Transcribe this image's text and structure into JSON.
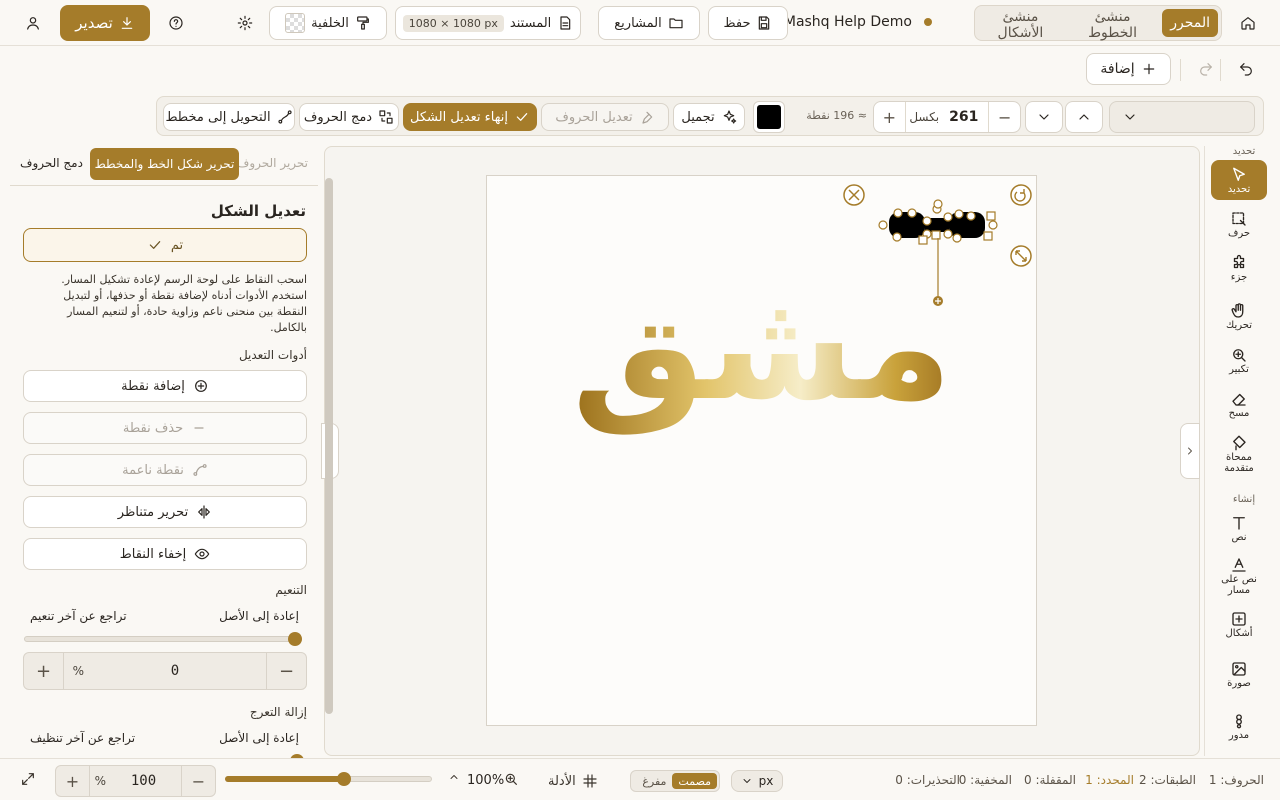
{
  "topbar": {
    "mode_tabs": [
      "المحرر",
      "منشئ الخطوط",
      "منشئ الأشكال"
    ],
    "project_name": "Mashq Help Demo",
    "save_label": "حفظ",
    "projects_label": "المشاريع",
    "document_label": "المستند",
    "document_size": "1080 × 1080 px",
    "background_label": "الخلفية",
    "export_label": "تصدير"
  },
  "row2": {
    "add_label": "إضافة"
  },
  "toolbar": {
    "size_value": "261",
    "size_unit": "بكسل",
    "pt_value": "≈ 196 نقطة",
    "color": "#000000",
    "beautify_label": "تجميل",
    "edit_letters_label": "تعديل الحروف",
    "finish_shape_label": "إنهاء تعديل الشكل",
    "merge_letters_label": "دمج الحروف",
    "convert_path_label": "التحويل إلى مخطط"
  },
  "rail": {
    "select_header": "تحديد",
    "create_header": "إنشاء",
    "items": [
      {
        "label": "تحديد",
        "icon": "cursor-icon"
      },
      {
        "label": "حرف",
        "icon": "letter-select-icon"
      },
      {
        "label": "جزء",
        "icon": "puzzle-icon"
      },
      {
        "label": "تحريك",
        "icon": "hand-icon"
      },
      {
        "label": "تكبير",
        "icon": "zoom-icon"
      },
      {
        "label": "مسح",
        "icon": "eraser-icon"
      },
      {
        "label": "ممحاة متقدمة",
        "icon": "advanced-eraser-icon"
      },
      {
        "label": "نص",
        "icon": "text-icon"
      },
      {
        "label": "نص على مسار",
        "icon": "text-path-icon"
      },
      {
        "label": "أشكال",
        "icon": "shapes-icon"
      },
      {
        "label": "صورة",
        "icon": "image-icon"
      },
      {
        "label": "مدور",
        "icon": "rotate-shape-icon"
      }
    ]
  },
  "canvas": {
    "artwork_text": "مشق",
    "gradient": [
      "#9a6f1a",
      "#e2c46a",
      "#f6edc8",
      "#c9a23b",
      "#a07422"
    ]
  },
  "panel": {
    "tabs": [
      "تحرير الحروف",
      "تحرير شكل الخط والمخطط",
      "دمج الحروف"
    ],
    "section_title": "تعديل الشكل",
    "done_label": "تم",
    "help_text": "اسحب النقاط على لوحة الرسم لإعادة تشكيل المسار. استخدم الأدوات أدناه لإضافة نقطة أو حذفها، أو لتبديل النقطة بين منحنى ناعم وزاوية حادة، أو لتنعيم المسار بالكامل.",
    "tools_title": "أدوات التعديل",
    "add_point": "إضافة نقطة",
    "delete_point": "حذف نقطة",
    "smooth_point": "نقطة ناعمة",
    "symmetric_edit": "تحرير متناظر",
    "hide_points": "إخفاء النقاط",
    "smoothing_title": "التنعيم",
    "reset_label": "إعادة إلى الأصل",
    "undo_smooth": "تراجع عن آخر تنعيم",
    "smoothing_value": "0",
    "smoothing_unit": "%",
    "smoothing_level": 1.0,
    "denoise_title": "إزالة التعرج",
    "undo_clean": "تراجع عن آخر تنظيف"
  },
  "statusbar": {
    "letters": "الحروف: 1",
    "layers": "الطبقات: 2",
    "selected": "المحدد: 1",
    "locked": "المقفلة: 0",
    "hidden": "المخفية: 0",
    "warnings": "التحذيرات: 0",
    "unit": "px",
    "fill_hollow": "مفرغ",
    "fill_solid": "مصمت",
    "guides_label": "الأدلة",
    "zoom_display": "100%",
    "zoom_value": "100",
    "zoom_unit": "%",
    "zoom_level": 0.58
  }
}
